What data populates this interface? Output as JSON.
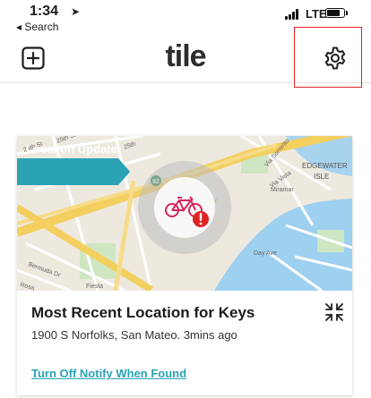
{
  "status_bar": {
    "time": "1:34",
    "back_label": "◂ Search",
    "network": "LTE",
    "battery_level": 0.8
  },
  "nav": {
    "logo": "tile",
    "add_icon": "plus-square-icon",
    "settings_icon": "gear-icon"
  },
  "card": {
    "badge": "Location Update",
    "title": "Most Recent Location for Keys",
    "address": "1900 S Norfolks, San Mateo. 3mins ago",
    "notify_link": "Turn Off Notify When Found",
    "map_labels": {
      "st25": "25th St",
      "st24": "24th St",
      "st25b": "25th",
      "edgewater": "EDGEWATER",
      "isle": "ISLE",
      "via_vistasa": "Via Vista",
      "via_sorrento": "Via Sorrento",
      "miramar": "Miramar",
      "day_ave": "Day Ave",
      "bermuda": "Bermuda Dr",
      "rosa": "Rosa",
      "tter": "tter",
      "fiesta": "Fiesta",
      "route": "92"
    },
    "colors": {
      "accent": "#2aa3b5",
      "alert": "#e02424",
      "bike": "#d6265b"
    }
  }
}
